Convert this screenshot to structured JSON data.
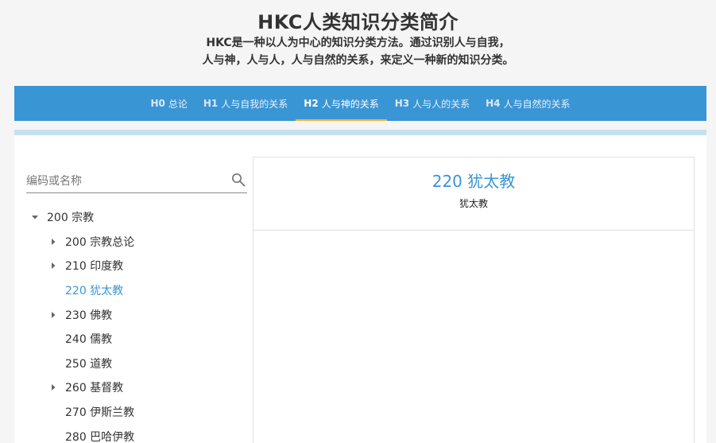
{
  "header": {
    "title": "HKC人类知识分类简介",
    "subtitle_line1": "HKC是一种以人为中心的知识分类方法。通过识别人与自我，",
    "subtitle_line2": "人与神，人与人，人与自然的关系，来定义一种新的知识分类。"
  },
  "nav": {
    "tabs": [
      {
        "code": "H0",
        "label": "总论"
      },
      {
        "code": "H1",
        "label": "人与自我的关系"
      },
      {
        "code": "H2",
        "label": "人与神的关系"
      },
      {
        "code": "H3",
        "label": "人与人的关系"
      },
      {
        "code": "H4",
        "label": "人与自然的关系"
      }
    ],
    "active_index": 2,
    "accent_color": "#3a95d4",
    "active_underline_color": "#f0b63c"
  },
  "search": {
    "placeholder": "编码或名称",
    "value": "",
    "icon": "search-icon"
  },
  "tree": {
    "root": {
      "label": "200 宗教",
      "expanded": true
    },
    "children": [
      {
        "label": "200 宗教总论",
        "has_children": true
      },
      {
        "label": "210 印度教",
        "has_children": true
      },
      {
        "label": "220 犹太教",
        "has_children": false,
        "selected": true
      },
      {
        "label": "230 佛教",
        "has_children": true
      },
      {
        "label": "240 儒教",
        "has_children": false
      },
      {
        "label": "250 道教",
        "has_children": false
      },
      {
        "label": "260 基督教",
        "has_children": true
      },
      {
        "label": "270 伊斯兰教",
        "has_children": false
      },
      {
        "label": "280 巴哈伊教",
        "has_children": false
      }
    ]
  },
  "detail": {
    "title": "220 犹太教",
    "subtitle": "犹太教"
  }
}
